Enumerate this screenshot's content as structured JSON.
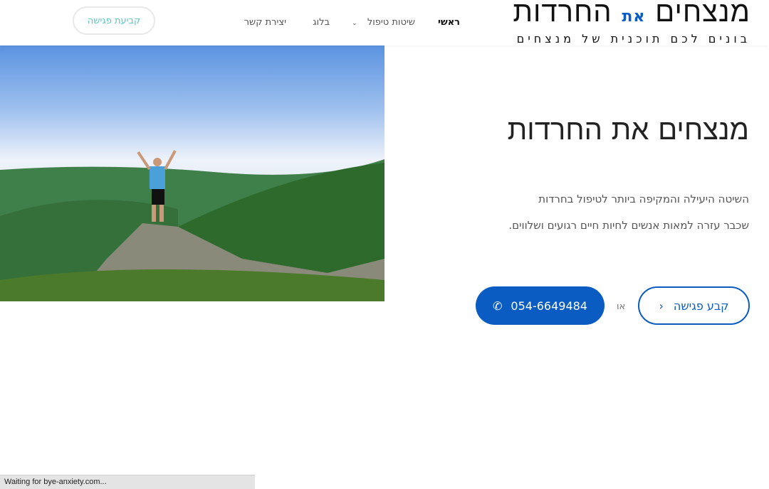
{
  "logo": {
    "main_before": "מנצחים",
    "main_accent": "את",
    "main_after": "החרדות",
    "tagline": "בונים לכם תוכנית של מנצחים"
  },
  "nav": {
    "items": [
      {
        "label": "ראשי",
        "active": true
      },
      {
        "label": "שיטות טיפול",
        "has_dropdown": true
      },
      {
        "label": "בלוג"
      },
      {
        "label": "יצירת קשר"
      }
    ],
    "cta": "קביעת פגישה"
  },
  "hero": {
    "title": "מנצחים את החרדות",
    "line1": "השיטה היעילה והמקיפה ביותר לטיפול בחרדות",
    "line2": "שכבר עזרה למאות אנשים לחיות חיים רגועים ושלווים.",
    "book_button": "קבע פגישה",
    "or": "או",
    "phone": "054-6649484"
  },
  "status_bar": "Waiting for bye-anxiety.com...",
  "colors": {
    "accent": "#0a5cc2",
    "cta_text": "#5cc6c0"
  }
}
